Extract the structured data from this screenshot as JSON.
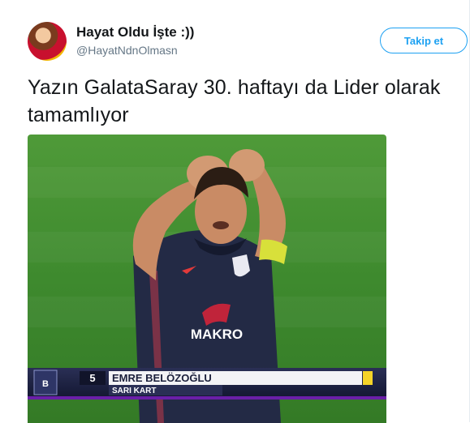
{
  "tweet": {
    "author": {
      "display_name": "Hayat Oldu İşte :))",
      "handle": "@HayatNdnOlmasn"
    },
    "follow_label": "Takip et",
    "text": "Yazın GalataSaray 30. haftayı da Lider olarak\ntamamlıyor"
  },
  "media": {
    "jersey_sponsor": "MAKRO",
    "caption": {
      "number": "5",
      "player_name": "EMRE BELÖZOĞLU",
      "event": "SARI KART"
    },
    "colors": {
      "pitch": "#3e8a2e",
      "jersey": "#232a45",
      "card": "#f5d328",
      "banner": "#1b1f3b",
      "accent": "#6a1fa8"
    }
  }
}
